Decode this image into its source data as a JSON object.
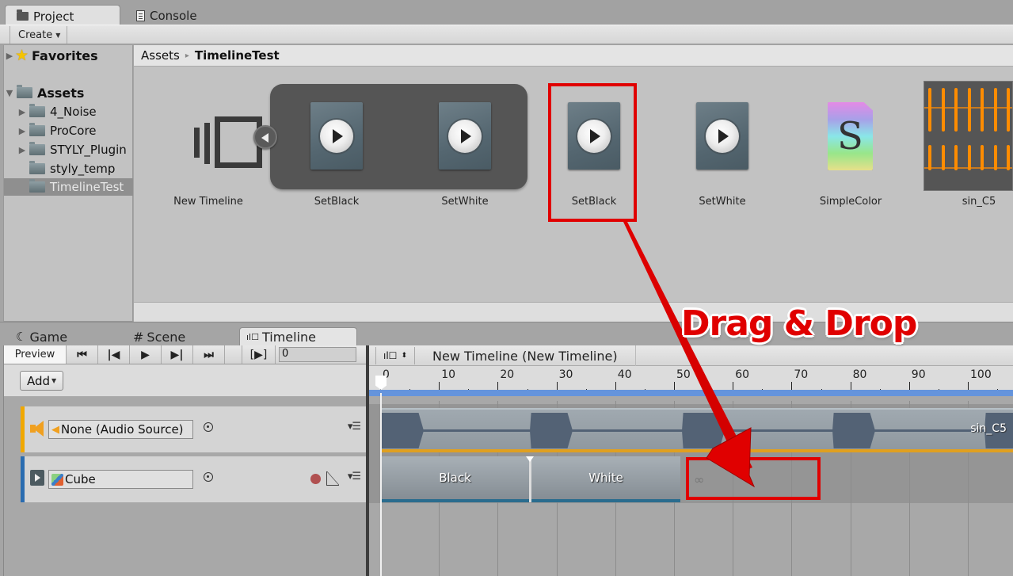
{
  "project_window": {
    "tabs": [
      {
        "label": "Project",
        "icon": "folder-icon",
        "active": true
      },
      {
        "label": "Console",
        "icon": "console-icon",
        "active": false
      }
    ],
    "create_label": "Create",
    "tree": {
      "favorites": "Favorites",
      "assets": "Assets",
      "folders": [
        {
          "label": "4_Noise",
          "expandable": true
        },
        {
          "label": "ProCore",
          "expandable": true
        },
        {
          "label": "STYLY_Plugin",
          "expandable": true
        },
        {
          "label": "styly_temp",
          "expandable": false
        },
        {
          "label": "TimelineTest",
          "expandable": false,
          "selected": true
        }
      ]
    },
    "breadcrumb": {
      "root": "Assets",
      "separator": "▸",
      "current": "TimelineTest"
    },
    "assets": [
      {
        "label": "New Timeline",
        "type": "timeline"
      },
      {
        "label": "SetBlack",
        "type": "playable"
      },
      {
        "label": "SetWhite",
        "type": "playable"
      },
      {
        "label": "SetBlack",
        "type": "playable",
        "highlighted": true
      },
      {
        "label": "SetWhite",
        "type": "playable"
      },
      {
        "label": "SimpleColor",
        "type": "shader"
      },
      {
        "label": "sin_C5",
        "type": "audio"
      }
    ]
  },
  "bottom_tabs": [
    {
      "label": "Game",
      "icon": "game-icon"
    },
    {
      "label": "Scene",
      "icon": "scene-grid-icon"
    },
    {
      "label": "Timeline",
      "icon": "timeline-icon",
      "active": true
    }
  ],
  "timeline": {
    "preview_label": "Preview",
    "transport": [
      "⏮",
      "|◀",
      "▶",
      "▶|",
      "⏭"
    ],
    "play_range_label": "[▶]",
    "frame_value": "0",
    "add_label": "Add",
    "asset_title": "New Timeline (New Timeline)",
    "ruler_ticks": [
      "0",
      "10",
      "20",
      "30",
      "40",
      "50",
      "60",
      "70",
      "80",
      "90",
      "100"
    ],
    "tracks": [
      {
        "type": "audio",
        "binding": "None (Audio Source)",
        "color": "#f0a800"
      },
      {
        "type": "animation",
        "binding": "Cube",
        "color": "#2a6cb0"
      }
    ],
    "audio_clip_name": "sin_C5",
    "anim_clips": [
      "Black",
      "White"
    ],
    "empty_clip_icon": "∞"
  },
  "annotation": {
    "label": "Drag & Drop",
    "color": "#e00000"
  }
}
